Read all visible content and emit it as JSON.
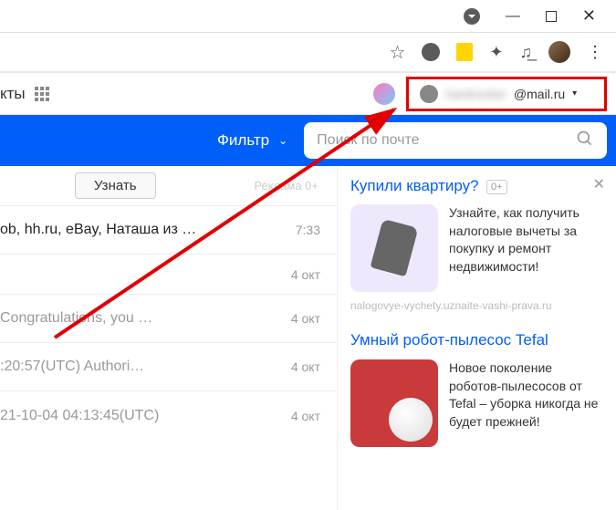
{
  "window": {
    "minimize": "—",
    "maximize": "□",
    "close": "✕"
  },
  "topnav": {
    "projects_label": "кты"
  },
  "account": {
    "username_blurred": "hardrocker",
    "domain": "@mail.ru"
  },
  "filter": {
    "label": "Фильтр"
  },
  "search": {
    "placeholder": "Поиск по почте"
  },
  "promo": {
    "button": "Узнать",
    "ad_label": "Реклама 0+"
  },
  "mails": [
    {
      "sender": "ob, hh.ru, eBay, Наташа из …",
      "time": "7:33",
      "style": "bold"
    },
    {
      "sender": "",
      "time": "4 окт",
      "style": "short"
    },
    {
      "sender": "Congratulations, you …",
      "time": "4 окт",
      "style": "gray"
    },
    {
      "sender": ":20:57(UTC)    Authori…",
      "time": "4 окт",
      "style": "gray"
    },
    {
      "sender": "21-10-04 04:13:45(UTC)",
      "time": "4 окт",
      "style": "gray"
    }
  ],
  "ads": [
    {
      "title": "Купили квартиру?",
      "age": "0+",
      "text": "Узнайте, как получить налоговые вычеты за покупку и ремонт недвижимости!",
      "source": "nalogovye-vychety.uznaite-vashi-prava.ru",
      "img": "keys"
    },
    {
      "title": "Умный робот-пылесос Tefal",
      "age": "",
      "text": "Новое поколение роботов-пылесосов от Tefal – уборка никогда не будет прежней!",
      "source": "",
      "img": "vacuum"
    }
  ]
}
